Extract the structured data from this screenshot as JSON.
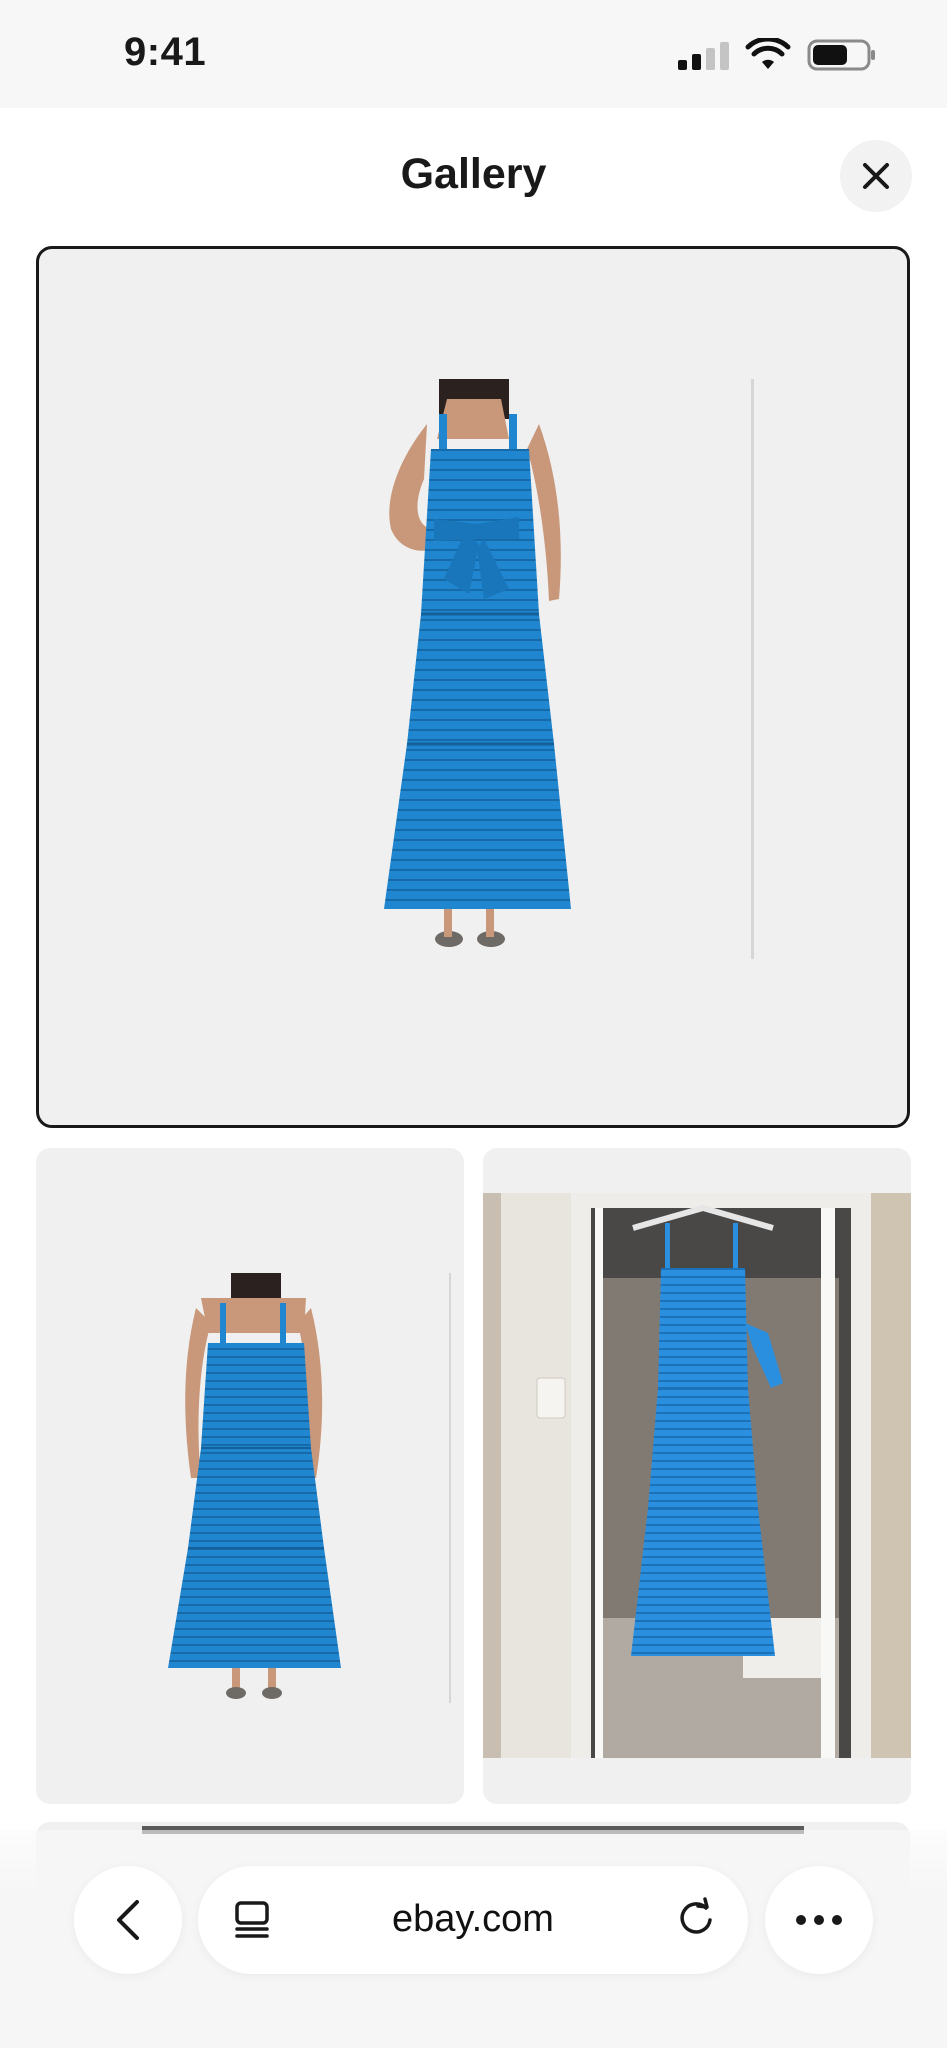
{
  "status_bar": {
    "time": "9:41",
    "signal_icon": "cellular-signal-icon",
    "wifi_icon": "wifi-icon",
    "battery_icon": "battery-icon"
  },
  "header": {
    "title": "Gallery",
    "close_icon": "close-icon"
  },
  "gallery": {
    "images": [
      {
        "name": "blue-tiered-maxi-dress-front",
        "selected": true
      },
      {
        "name": "blue-tiered-maxi-dress-back",
        "selected": false
      },
      {
        "name": "blue-tiered-maxi-dress-on-hanger",
        "selected": false
      },
      {
        "name": "gallery-image-4",
        "selected": false
      }
    ],
    "dress_color": "#1f86cf"
  },
  "browser": {
    "url": "ebay.com",
    "back_icon": "chevron-left-icon",
    "tabs_icon": "tabs-icon",
    "reload_icon": "reload-icon",
    "more_icon": "more-icon"
  }
}
